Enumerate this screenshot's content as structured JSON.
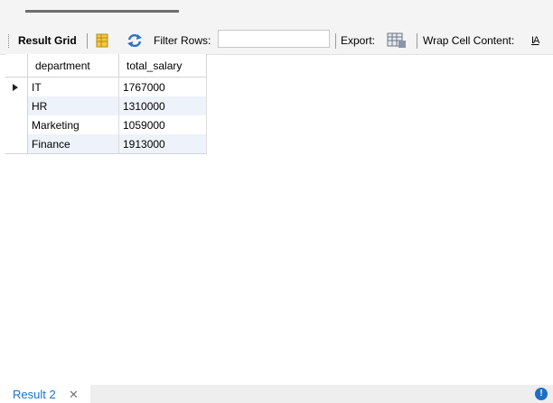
{
  "toolbar": {
    "result_grid_label": "Result Grid",
    "filter_rows_label": "Filter Rows:",
    "filter_value": "",
    "export_label": "Export:",
    "wrap_label": "Wrap Cell Content:",
    "wrap_icon_glyph": "IA"
  },
  "grid": {
    "columns": [
      "department",
      "total_salary"
    ],
    "rows": [
      {
        "department": "IT",
        "total_salary": "1767000"
      },
      {
        "department": "HR",
        "total_salary": "1310000"
      },
      {
        "department": "Marketing",
        "total_salary": "1059000"
      },
      {
        "department": "Finance",
        "total_salary": "1913000"
      }
    ]
  },
  "bottom": {
    "tab_label": "Result 2",
    "close_glyph": "✕",
    "info_glyph": "!"
  },
  "colors": {
    "accent": "#1a73c7",
    "alt_row": "#eef2fb"
  }
}
